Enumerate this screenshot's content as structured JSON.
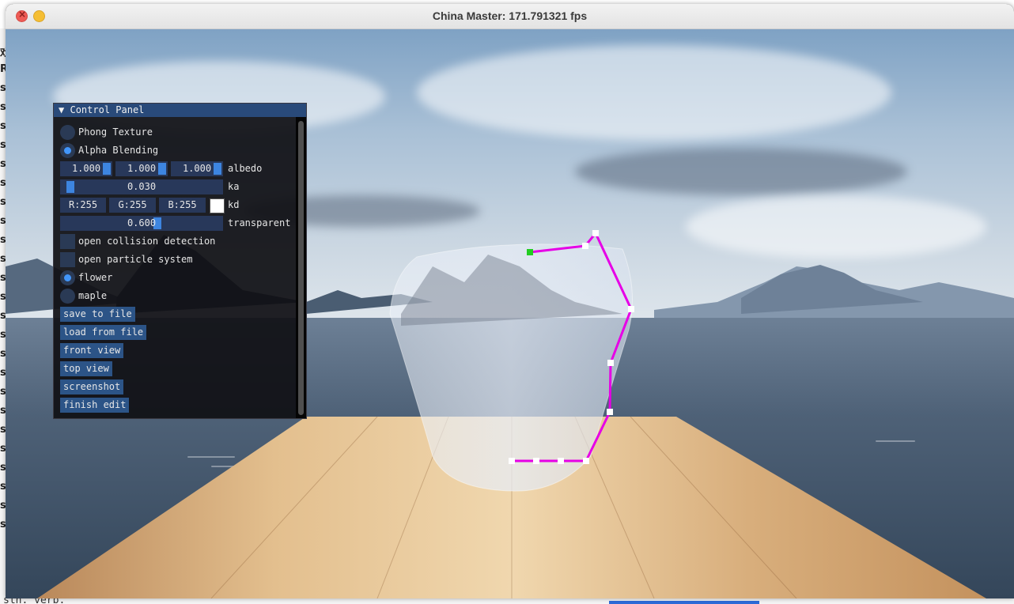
{
  "window": {
    "title": "China Master: 171.791321 fps"
  },
  "desktop": {
    "left_chars": [
      "戏",
      "R",
      "s",
      "s",
      "s",
      "s",
      "s",
      "s",
      "s",
      "s",
      "s",
      "s",
      "s",
      "s",
      "s",
      "s",
      "s",
      "s",
      "s",
      "s",
      "s",
      "s",
      "s",
      "s",
      "s",
      "s"
    ],
    "bottom_text": "sth. verb."
  },
  "panel": {
    "title": "Control Panel",
    "collapse_glyph": "▼",
    "phong_texture": {
      "label": "Phong Texture",
      "selected": false
    },
    "alpha_blending": {
      "label": "Alpha Blending",
      "selected": true
    },
    "albedo": {
      "values": [
        "1.000",
        "1.000",
        "1.000"
      ],
      "label": "albedo"
    },
    "ka": {
      "value": "0.030",
      "label": "ka",
      "fraction": 0.03
    },
    "kd": {
      "r": "R:255",
      "g": "G:255",
      "b": "B:255",
      "label": "kd",
      "color": "#ffffff"
    },
    "transparent": {
      "value": "0.600",
      "label": "transparent",
      "fraction": 0.6
    },
    "collision": {
      "label": "open collision detection",
      "checked": false
    },
    "particles": {
      "label": "open particle system",
      "checked": false
    },
    "flower": {
      "label": "flower",
      "selected": true
    },
    "maple": {
      "label": "maple",
      "selected": false
    },
    "buttons": {
      "save": "save to file",
      "load": "load from file",
      "front": "front view",
      "top": "top view",
      "screenshot": "screenshot",
      "finish": "finish edit"
    }
  },
  "colors": {
    "accent": "#4296fa",
    "panel_header": "#294a7a",
    "button": "#2c5487",
    "curve": "#e600e6",
    "control_point_active": "#22cc22"
  }
}
